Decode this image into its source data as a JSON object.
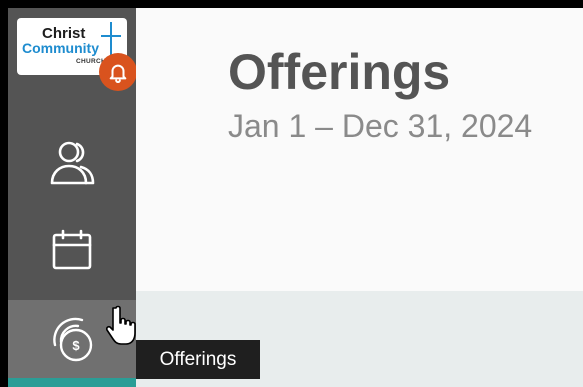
{
  "sidebar": {
    "logo": {
      "line1": "Christ",
      "line2": "Community",
      "line3": "CHURCH"
    },
    "items": [
      {
        "id": "people",
        "icon": "people-icon"
      },
      {
        "id": "calendar",
        "icon": "calendar-icon"
      },
      {
        "id": "offerings",
        "icon": "offerings-coin-icon",
        "hovered": true
      }
    ],
    "notification_icon": "bell-icon"
  },
  "header": {
    "title": "Offerings",
    "date_range": "Jan 1 – Dec 31, 2024"
  },
  "tooltip": {
    "text": "Offerings"
  },
  "colors": {
    "sidebar": "#545454",
    "sidebar_hover": "#707070",
    "bell_badge": "#d9531e",
    "logo_blue": "#1e8ccf",
    "active_strip": "#2a9d96",
    "tooltip_bg": "#1f1f1f"
  }
}
